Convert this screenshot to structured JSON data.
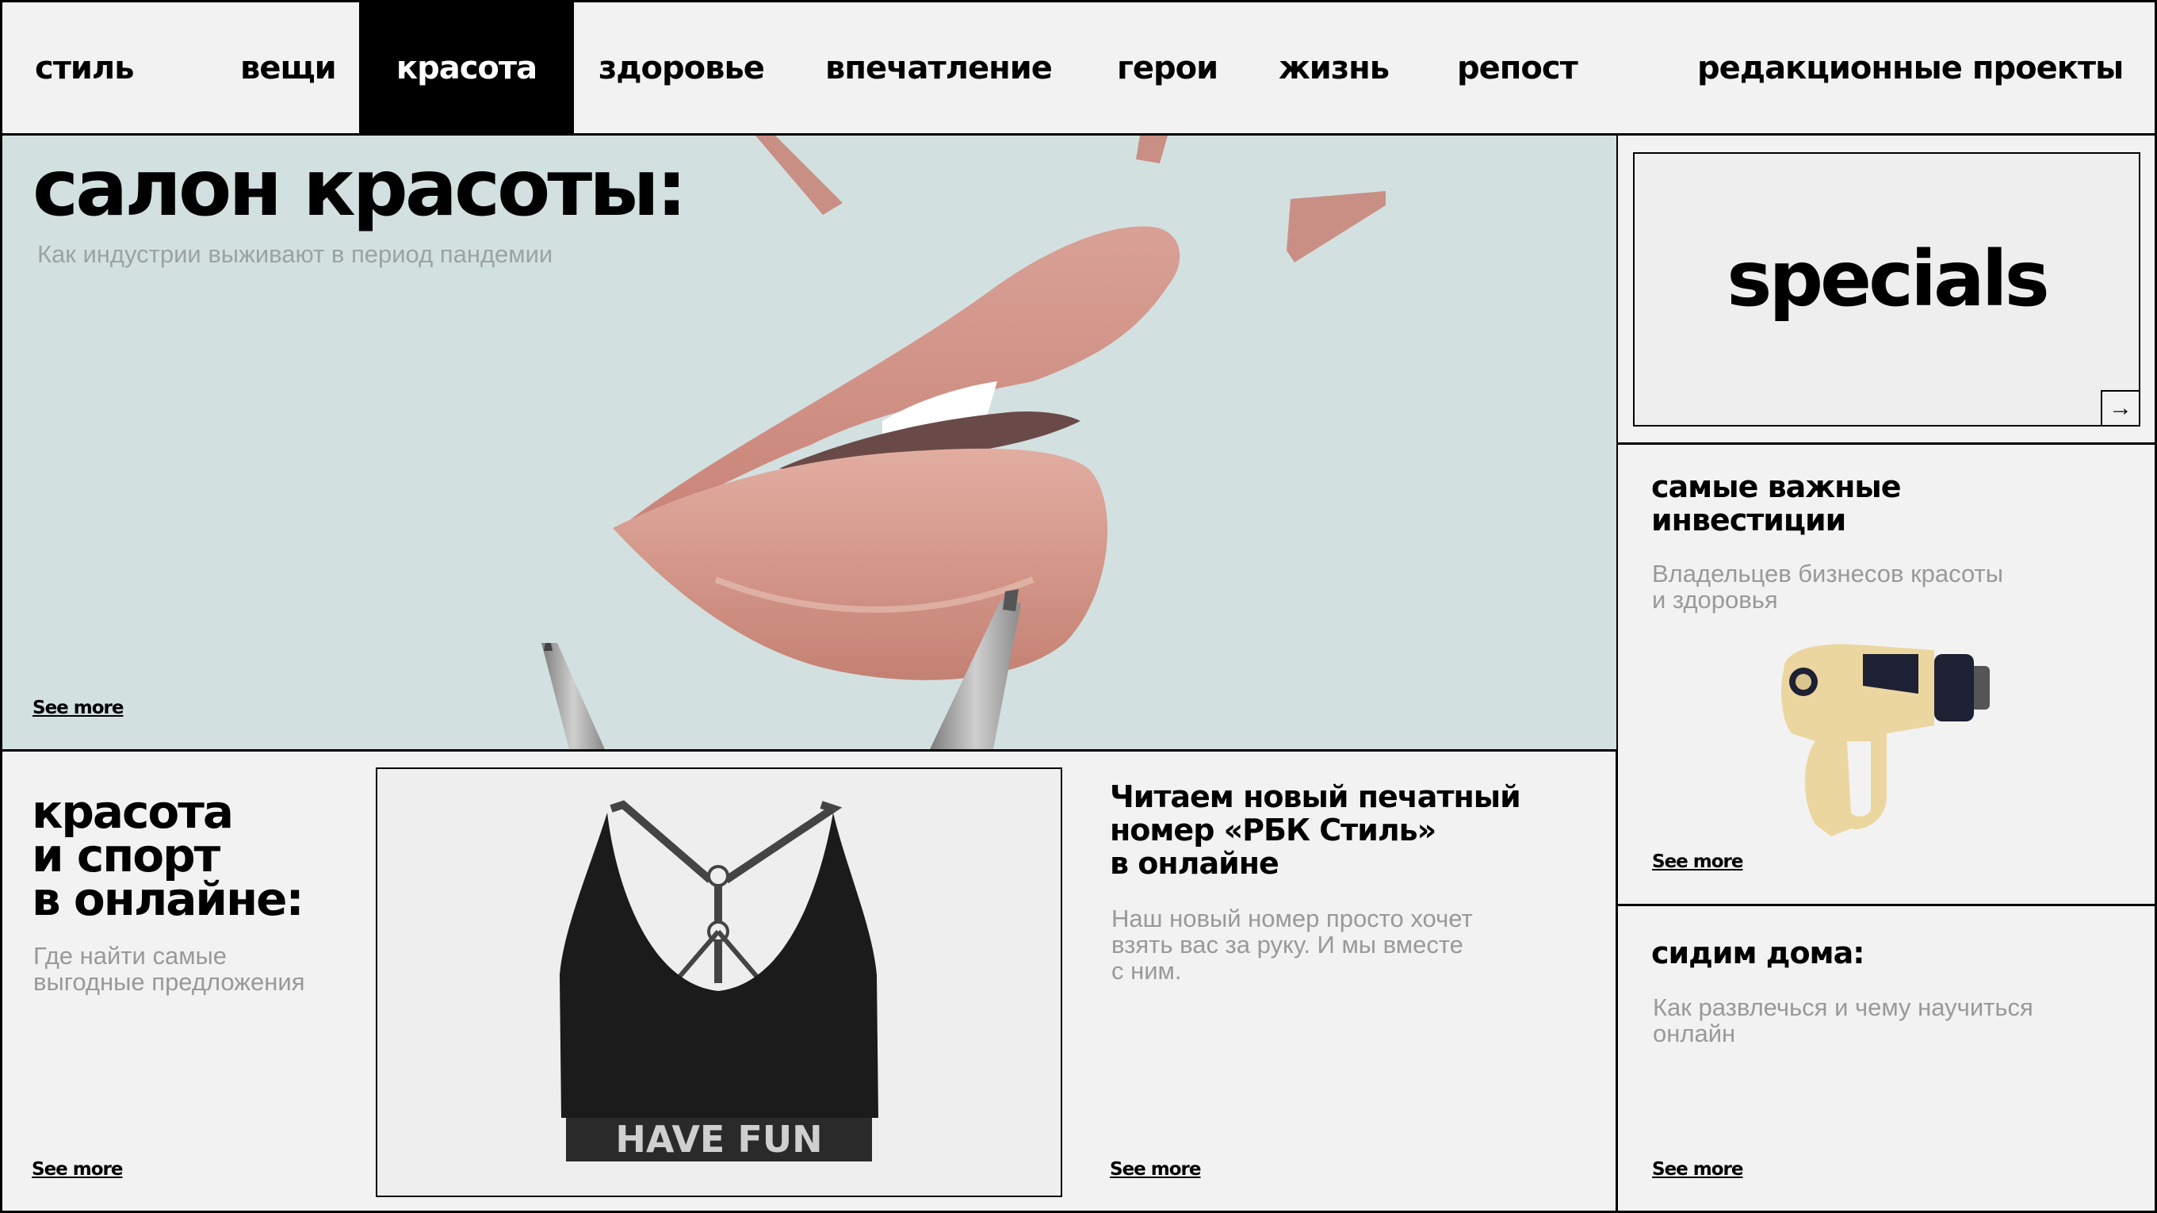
{
  "nav": {
    "items": [
      "стиль",
      "вещи",
      "красота",
      "здоровье",
      "впечатление",
      "герои",
      "жизнь",
      "репост",
      "редакционные проекты"
    ],
    "active": "красота"
  },
  "hero": {
    "title": "салон красоты:",
    "subtitle": "Как индустрии выживают в период пандемии",
    "see_more": "See more"
  },
  "specials": {
    "title": "specials",
    "arrow": "→"
  },
  "investments": {
    "title_line1": "самые важные",
    "title_line2": "инвестиции",
    "subtitle_line1": "Владельцев бизнесов красоты",
    "subtitle_line2": "и здоровья",
    "see_more": "See more"
  },
  "home": {
    "title": "сидим дома:",
    "subtitle_line1": "Как развлечься и чему научиться",
    "subtitle_line2": "онлайн",
    "see_more": "See more"
  },
  "sport": {
    "title_line1": "красота",
    "title_line2": "и спорт",
    "title_line3": "в онлайне:",
    "subtitle_line1": "Где найти самые",
    "subtitle_line2": "выгодные предложения",
    "see_more": "See more"
  },
  "product": {
    "print_text": "HAVE FUN"
  },
  "magazine": {
    "title_line1": "Читаем новый печатный",
    "title_line2": "номер «РБК Стиль»",
    "title_line3": "в онлайне",
    "subtitle_line1": "Наш новый номер просто хочет",
    "subtitle_line2": "взять вас за руку. И мы вместе",
    "subtitle_line3": "с ним.",
    "see_more": "See more"
  }
}
